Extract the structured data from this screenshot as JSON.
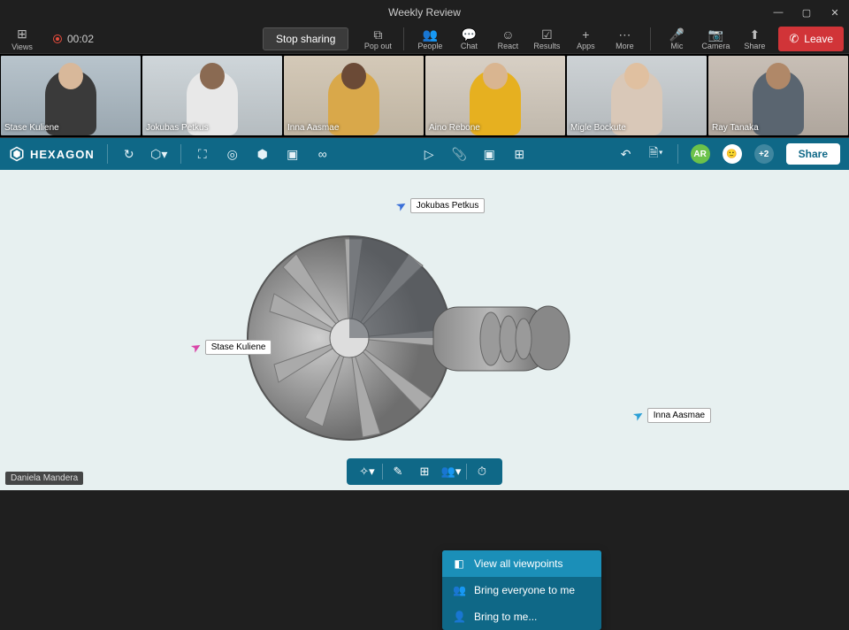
{
  "window": {
    "title": "Weekly Review"
  },
  "meeting": {
    "views_label": "Views",
    "rec_time": "00:02",
    "stop_sharing": "Stop sharing",
    "tools": {
      "popout": "Pop out",
      "people": "People",
      "chat": "Chat",
      "react": "React",
      "results": "Results",
      "apps": "Apps",
      "more": "More",
      "mic": "Mic",
      "camera": "Camera",
      "share": "Share"
    },
    "leave": "Leave"
  },
  "participants": [
    {
      "name": "Stase Kuliene",
      "bg": "linear-gradient(#b8c4cc,#9aa7b0)",
      "body": "#3a3a3a",
      "head": "#d8b89a"
    },
    {
      "name": "Jokubas Petkus",
      "bg": "linear-gradient(#cfd6da,#b5bcc0)",
      "body": "#e8e8e8",
      "head": "#8a6a52"
    },
    {
      "name": "Inna Aasmae",
      "bg": "linear-gradient(#d4c9b8,#bfb4a2)",
      "body": "#d9a84a",
      "head": "#6b4a36"
    },
    {
      "name": "Aino Rebone",
      "bg": "linear-gradient(#d8d0c5,#c0b8ac)",
      "body": "#e6b020",
      "head": "#d9b590"
    },
    {
      "name": "Migle Bockute",
      "bg": "linear-gradient(#cdd2d5,#b4b9bc)",
      "body": "#d9c8b8",
      "head": "#e0c0a0"
    },
    {
      "name": "Ray Tanaka",
      "bg": "linear-gradient(#c8bfb6,#afa69d)",
      "body": "#5a6570",
      "head": "#b08868"
    }
  ],
  "app": {
    "brand": "HEXAGON",
    "overflow_count": "+2",
    "share": "Share",
    "avatars": {
      "ar": {
        "initials": "AR",
        "bg": "#6cc24a"
      }
    }
  },
  "cursors": {
    "petkus": {
      "name": "Jokubas Petkus",
      "color": "#3a6fd8"
    },
    "kuliene": {
      "name": "Stase Kuliene",
      "color": "#d946a8"
    },
    "aasmae": {
      "name": "Inna Aasmae",
      "color": "#2a9fd6"
    }
  },
  "menu": {
    "view_all": "View all viewpoints",
    "bring_everyone": "Bring everyone to me",
    "bring_to_me": "Bring to me..."
  },
  "footer_user": "Daniela Mandera"
}
